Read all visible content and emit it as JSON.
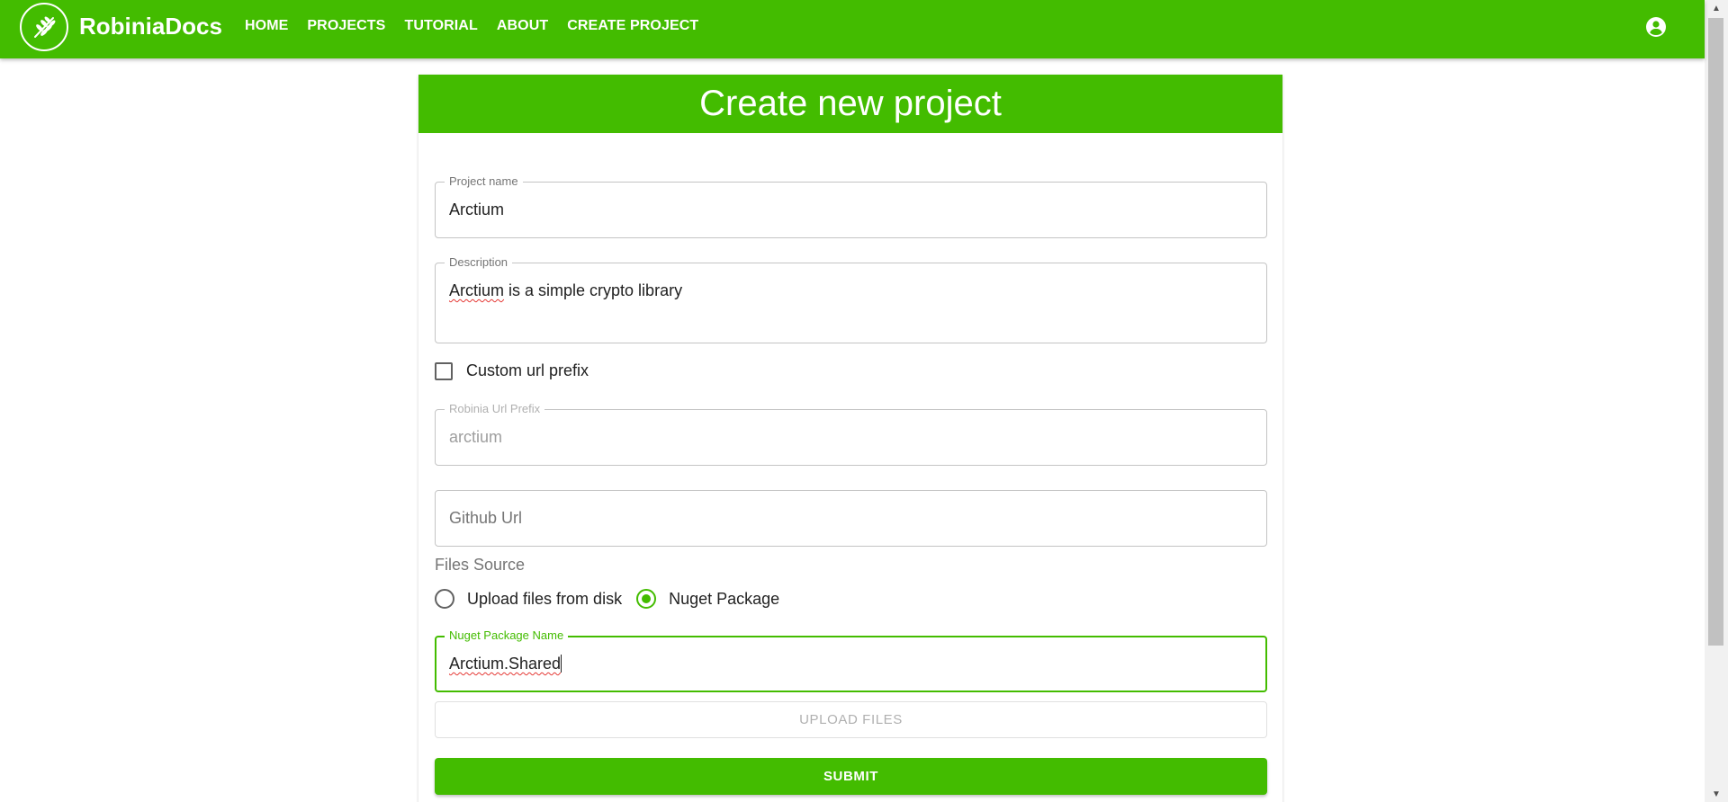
{
  "app": {
    "brand": "RobiniaDocs",
    "logo_icon": "robinia-leaf-icon",
    "account_icon": "account-circle-icon",
    "colors": {
      "primary": "#43bc00",
      "text": "#212121"
    }
  },
  "nav": {
    "items": [
      {
        "label": "HOME"
      },
      {
        "label": "PROJECTS"
      },
      {
        "label": "TUTORIAL"
      },
      {
        "label": "ABOUT"
      },
      {
        "label": "CREATE PROJECT"
      }
    ]
  },
  "form": {
    "title": "Create new project",
    "project_name": {
      "label": "Project name",
      "value": "Arctium"
    },
    "description": {
      "label": "Description",
      "value_misspelled": "Arctium",
      "value_rest": " is a simple crypto library"
    },
    "custom_url_prefix": {
      "label": "Custom url prefix",
      "checked": false
    },
    "url_prefix": {
      "label": "Robinia Url Prefix",
      "value": "arctium",
      "disabled": true
    },
    "github_url": {
      "placeholder": "Github Url",
      "value": ""
    },
    "files_source": {
      "label": "Files Source",
      "options": [
        {
          "label": "Upload files from disk",
          "selected": false
        },
        {
          "label": "Nuget Package",
          "selected": true
        }
      ]
    },
    "nuget_package": {
      "label": "Nuget Package Name",
      "value": "Arctium.Shared"
    },
    "upload_button": "UPLOAD FILES",
    "submit_button": "SUBMIT"
  }
}
